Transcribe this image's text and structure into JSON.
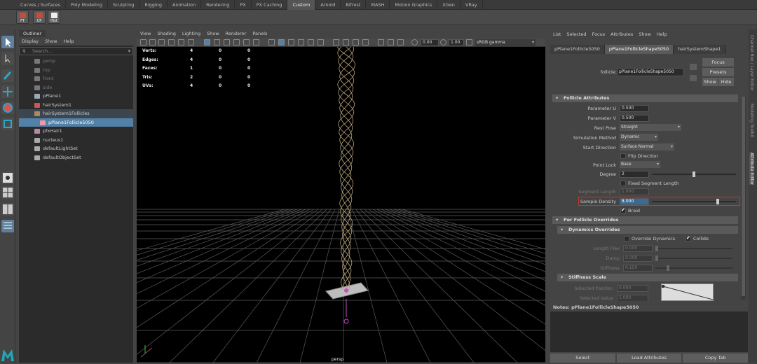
{
  "shelf_tabs": [
    "Curves / Surfaces",
    "Poly Modeling",
    "Sculpting",
    "Rigging",
    "Animation",
    "Rendering",
    "PX",
    "PX Caching",
    "Custom",
    "Arnold",
    "Bifrost",
    "MASH",
    "Motion Graphics",
    "XGen",
    "VRay"
  ],
  "shelf_active": "Custom",
  "shelf_buttons": [
    "FT",
    "CP",
    "Hist"
  ],
  "outliner": {
    "title": "Outliner",
    "menu": [
      "Display",
      "Show",
      "Help"
    ],
    "search_placeholder": "Search...",
    "items": [
      {
        "label": "persp",
        "state": "dim",
        "icon": "camera-icon"
      },
      {
        "label": "top",
        "state": "dim",
        "icon": "camera-icon"
      },
      {
        "label": "front",
        "state": "dim",
        "icon": "camera-icon"
      },
      {
        "label": "side",
        "state": "dim",
        "icon": "camera-icon"
      },
      {
        "label": "pPlane1",
        "state": "normal",
        "icon": "mesh-icon"
      },
      {
        "label": "hairSystem1",
        "state": "normal",
        "icon": "hair-system-icon"
      },
      {
        "label": "hairSystem1Follicles",
        "state": "highlight",
        "icon": "group-icon"
      },
      {
        "label": "pPlane1Follicle5050",
        "state": "selected",
        "icon": "follicle-icon"
      },
      {
        "label": "pfxHair1",
        "state": "normal",
        "icon": "pfx-icon"
      },
      {
        "label": "nucleus1",
        "state": "normal",
        "icon": "nucleus-icon"
      },
      {
        "label": "defaultLightSet",
        "state": "normal",
        "icon": "set-icon"
      },
      {
        "label": "defaultObjectSet",
        "state": "normal",
        "icon": "set-icon"
      }
    ]
  },
  "viewport": {
    "menu": [
      "View",
      "Shading",
      "Lighting",
      "Show",
      "Renderer",
      "Panels"
    ],
    "exposure": "0.00",
    "gamma": "1.00",
    "color_space": "sRGB gamma",
    "camera_label": "persp",
    "hud": [
      {
        "label": "Verts:",
        "a": "4",
        "b": "0",
        "c": "0"
      },
      {
        "label": "Edges:",
        "a": "4",
        "b": "0",
        "c": "0"
      },
      {
        "label": "Faces:",
        "a": "1",
        "b": "0",
        "c": "0"
      },
      {
        "label": "Tris:",
        "a": "2",
        "b": "0",
        "c": "0"
      },
      {
        "label": "UVs:",
        "a": "4",
        "b": "0",
        "c": "0"
      }
    ]
  },
  "attr": {
    "menu": [
      "List",
      "Selected",
      "Focus",
      "Attributes",
      "Show",
      "Help"
    ],
    "tabs": [
      "pPlane1Follicle5050",
      "pPlane1FollicleShape5050",
      "hairSystemShape1"
    ],
    "active_tab": "pPlane1FollicleShape5050",
    "node_label": "follicle:",
    "node_value": "pPlane1FollicleShape5050",
    "focus": "Focus",
    "presets": "Presets",
    "show": "Show",
    "hide": "Hide",
    "section_follicle": "Follicle Attributes",
    "param_u_label": "Parameter U",
    "param_u": "0.500",
    "param_v_label": "Parameter V",
    "param_v": "0.500",
    "rest_pose_label": "Rest Pose",
    "rest_pose": "Straight",
    "sim_method_label": "Simulation Method",
    "sim_method": "Dynamic",
    "start_dir_label": "Start Direction",
    "start_dir": "Surface Normal",
    "flip_direction": "Flip Direction",
    "point_lock_label": "Point Lock",
    "point_lock": "Base",
    "degree_label": "Degree",
    "degree": "2",
    "fixed_seg": "Fixed Segment Length",
    "seg_length_label": "Segment Length",
    "seg_length": "1.000",
    "sample_density_label": "Sample Density",
    "sample_density": "8.000",
    "braid": "Braid",
    "section_per_follicle": "Per Follicle Overrides",
    "section_dynamics": "Dynamics Overrides",
    "override_dynamics": "Override Dynamics",
    "collide": "Collide",
    "length_flex_label": "Length Flex",
    "length_flex": "0.000",
    "damp_label": "Damp",
    "damp": "0.000",
    "stiffness_label": "Stiffness",
    "stiffness": "0.150",
    "section_stiffness": "Stiffness Scale",
    "selected_position_label": "Selected Position",
    "selected_position": "0.000",
    "selected_value_label": "Selected Value",
    "selected_value": "1.000",
    "notes_label": "Notes:",
    "notes_node": "pPlane1FollicleShape5050",
    "bottom_buttons": [
      "Select",
      "Load Attributes",
      "Copy Tab"
    ]
  },
  "side_tabs": [
    "Channel Box / Layer Editor",
    "Modeling Toolkit",
    "Attribute Editor"
  ],
  "colors": {
    "selection": "#5181a8",
    "hair_strand": "#b9a47a",
    "highlight_border": "#c0392b",
    "maya_logo": "#23a6b8"
  }
}
